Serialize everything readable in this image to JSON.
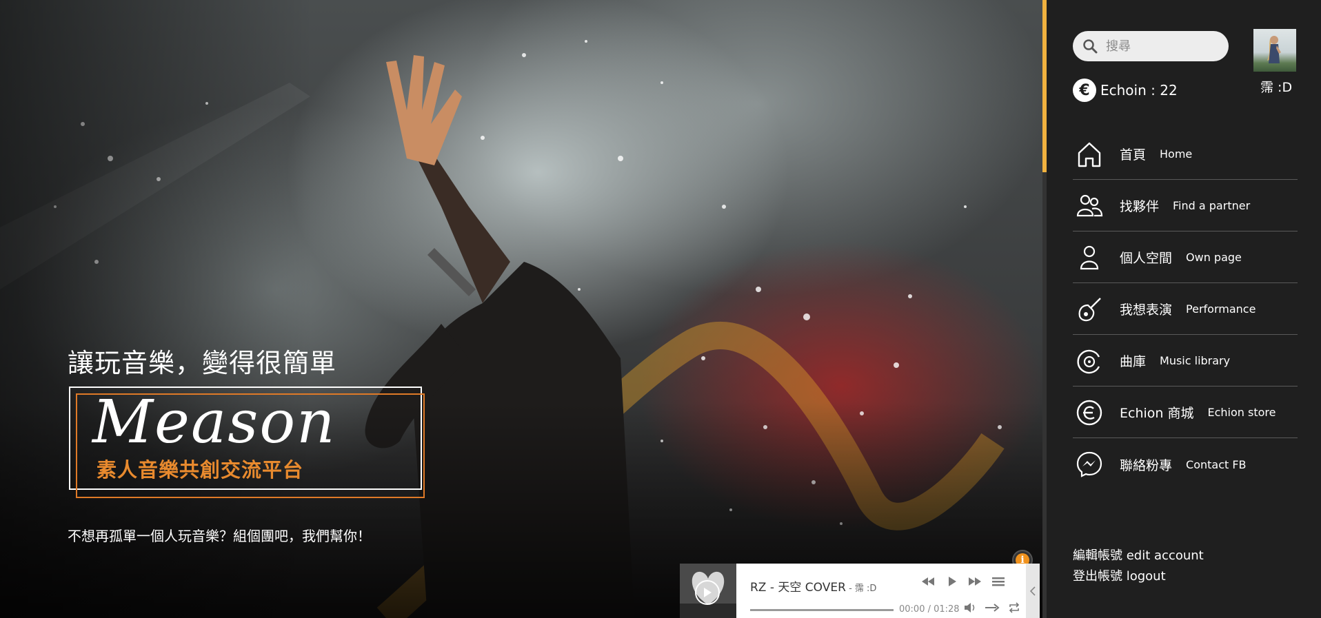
{
  "hero": {
    "heading": "讓玩音樂，變得很簡單",
    "logo_word": "Meason",
    "logo_subtitle": "素人音樂共創交流平台",
    "tagline": "不想再孤單一個人玩音樂？組個團吧，我們幫你！",
    "info_icon": "i"
  },
  "player": {
    "song_title": "RZ - 天空 COVER",
    "artist": " - 霈 :D",
    "time": "00:00 / 01:28",
    "progress": 0
  },
  "sidebar": {
    "search_placeholder": "搜尋",
    "echoin_label": "Echoin : 22",
    "coin_glyph": "€",
    "username": "霈 :D",
    "nav": [
      {
        "zh": "首頁",
        "en": "Home",
        "icon": "home-icon"
      },
      {
        "zh": "找夥伴",
        "en": "Find a partner",
        "icon": "people-icon"
      },
      {
        "zh": "個人空間",
        "en": "Own page",
        "icon": "person-icon"
      },
      {
        "zh": "我想表演",
        "en": "Performance",
        "icon": "guitar-icon"
      },
      {
        "zh": "曲庫",
        "en": "Music library",
        "icon": "disc-icon"
      },
      {
        "zh": "Echion 商城",
        "en": "Echion store",
        "icon": "coin-icon"
      },
      {
        "zh": "聯絡粉專",
        "en": "Contact FB",
        "icon": "messenger-icon"
      }
    ],
    "edit_account": "編輯帳號 edit account",
    "logout": "登出帳號 logout"
  },
  "colors": {
    "accent": "#f1b23f",
    "logo_orange": "#e88a2e",
    "sidebar_bg": "#1f1f1f"
  }
}
